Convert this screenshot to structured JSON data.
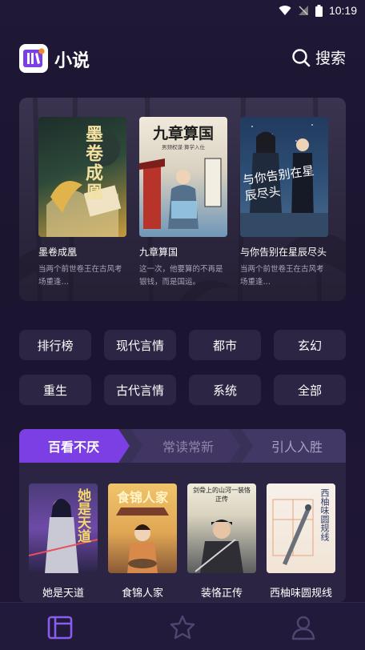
{
  "status": {
    "time": "10:19"
  },
  "header": {
    "app_title": "小说",
    "search_label": "搜索"
  },
  "featured": [
    {
      "title": "墨卷成凰",
      "desc": "当两个前世卷王在古风考场重逢…",
      "cover_text": "墨卷成凰"
    },
    {
      "title": "九章算国",
      "desc": "这一次，他要算的不再是银钱，而是国运。",
      "cover_text": "九章算国",
      "cover_sub": "男频权谋·算学入仕"
    },
    {
      "title": "与你告别在星辰尽头",
      "desc": "当两个前世卷王在古风考场重逢…",
      "cover_text": "与你告别在星辰尽头"
    }
  ],
  "categories": [
    "排行榜",
    "现代言情",
    "都市",
    "玄幻",
    "重生",
    "古代言情",
    "系统",
    "全部"
  ],
  "rank_tabs": [
    "百看不厌",
    "常读常新",
    "引人入胜"
  ],
  "rank_books": [
    {
      "title": "她是天道",
      "cover_text": "她是天道"
    },
    {
      "title": "食锦人家",
      "cover_text": "食锦人家"
    },
    {
      "title": "装恪正传",
      "cover_text": "剑骨上的山河一装恪正传"
    },
    {
      "title": "西柚味圆规线",
      "cover_text": "西柚味圆规线"
    }
  ],
  "colors": {
    "accent": "#7b3fe4",
    "tab_inactive": "#3a3158",
    "background": "#1f1836"
  },
  "icons": {
    "logo": "book-logo-icon",
    "search": "search-icon",
    "nav": [
      "bookshelf-icon",
      "star-icon",
      "profile-icon"
    ]
  }
}
